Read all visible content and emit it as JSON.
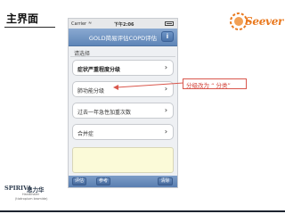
{
  "slide": {
    "title": "主界面"
  },
  "logo": {
    "text": "Seever"
  },
  "phone": {
    "status": {
      "carrier": "Carrier",
      "wifi": "≈",
      "time": "下午2:06"
    },
    "nav": {
      "title": "GOLD简易评估COPD评估",
      "info": "i"
    },
    "prompt": "请选择",
    "options": [
      {
        "label": "症状严重程度分级",
        "bold": true
      },
      {
        "label": "肺功能分级",
        "bold": false
      },
      {
        "label": "过去一年急性加重次数",
        "bold": false
      },
      {
        "label": "合并症",
        "bold": false
      }
    ],
    "toolbar": {
      "left": "评估",
      "middle": "参考",
      "right": "清除"
    }
  },
  "annotation": {
    "text": "分级改为 “ 分类”"
  },
  "colors": {
    "annotation_red": "#d9574d",
    "nav_blue": "#5f86b8",
    "logo_orange": "#e9791f"
  },
  "footer_logo": {
    "brand": "SPIRIVA",
    "cn": "思力华",
    "line1": "Handihaler",
    "line2": "(tiotropium bromide)"
  }
}
